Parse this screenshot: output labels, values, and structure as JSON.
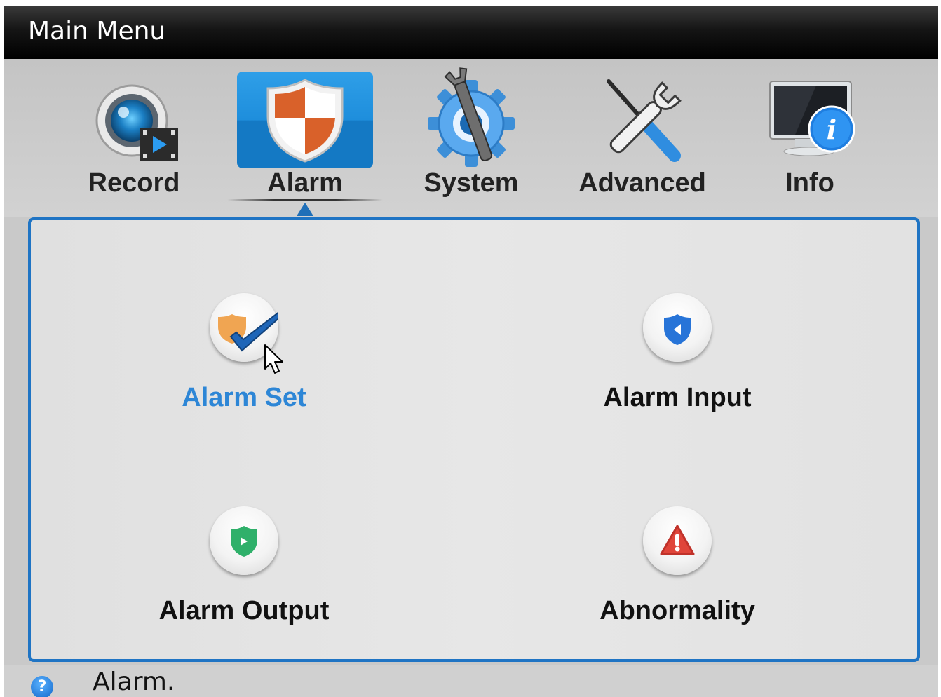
{
  "window": {
    "title": "Main Menu"
  },
  "top_menu": {
    "items": [
      {
        "label": "Record",
        "icon": "camera-record-icon"
      },
      {
        "label": "Alarm",
        "icon": "alarm-shield-icon",
        "selected": true
      },
      {
        "label": "System",
        "icon": "system-gear-icon"
      },
      {
        "label": "Advanced",
        "icon": "tools-icon"
      },
      {
        "label": "Info",
        "icon": "monitor-info-icon"
      }
    ]
  },
  "alarm_panel": {
    "items": [
      {
        "label": "Alarm Set",
        "icon": "alarm-set-icon",
        "active": true
      },
      {
        "label": "Alarm Input",
        "icon": "alarm-input-icon"
      },
      {
        "label": "Alarm Output",
        "icon": "alarm-output-icon"
      },
      {
        "label": "Abnormality",
        "icon": "abnormality-icon"
      }
    ]
  },
  "status": {
    "help_icon": "help-icon",
    "text": "Alarm."
  },
  "colors": {
    "accent": "#1f74c4",
    "active_label": "#2d86d6",
    "titlebar": "#000000"
  }
}
